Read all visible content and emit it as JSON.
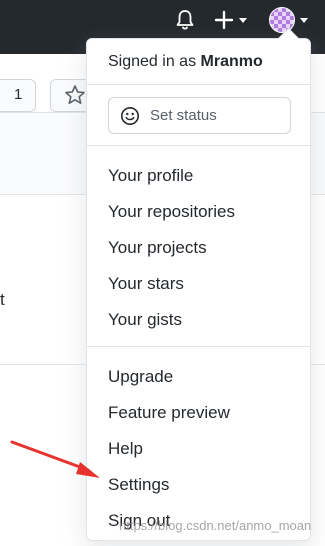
{
  "header": {
    "bell_icon": "bell-icon",
    "plus_icon": "plus-icon",
    "avatar_icon": "user-avatar"
  },
  "background": {
    "count_value": "1",
    "fragment_text": "t"
  },
  "dropdown": {
    "signed_in_prefix": "Signed in as ",
    "username": "Mranmo",
    "status_button_label": "Set status",
    "sections": [
      [
        "Your profile",
        "Your repositories",
        "Your projects",
        "Your stars",
        "Your gists"
      ],
      [
        "Upgrade",
        "Feature preview",
        "Help",
        "Settings",
        "Sign out"
      ]
    ]
  },
  "watermark": "https://blog.csdn.net/anmo_moan",
  "colors": {
    "header_bg": "#24292e",
    "text": "#24292e",
    "border": "#e1e4e8",
    "arrow": "#e8322d"
  }
}
